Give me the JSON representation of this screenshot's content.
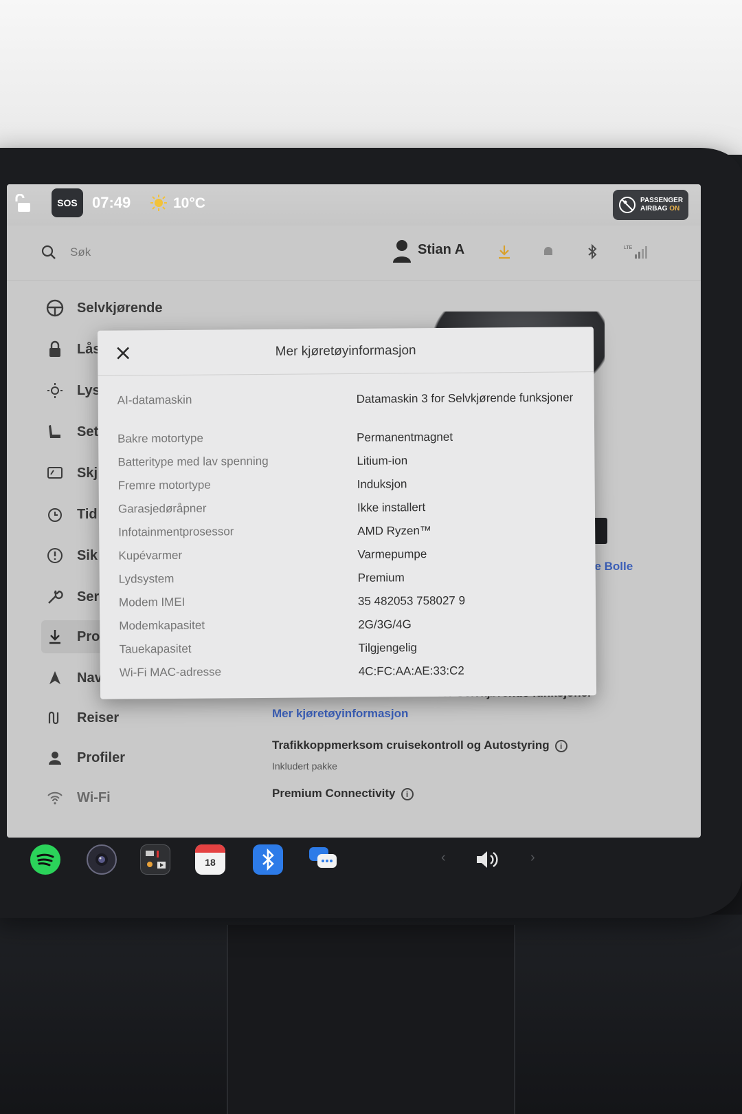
{
  "status_bar": {
    "sos": "SOS",
    "time": "07:49",
    "temperature": "10°C",
    "airbag_line1": "PASSENGER",
    "airbag_line2": "AIRBAG",
    "airbag_state": "ON",
    "airbag_state_color": "#e7b04a"
  },
  "header": {
    "search_placeholder": "Søk",
    "user_name": "Stian A",
    "icons": [
      "download-icon",
      "bell-icon",
      "bluetooth-icon",
      "lte-signal-icon"
    ],
    "download_color": "#d9a12a"
  },
  "sidebar": {
    "items": [
      {
        "label": "Selvkjørende",
        "icon": "steering-wheel-icon"
      },
      {
        "label": "Lås",
        "icon": "lock-icon"
      },
      {
        "label": "Lys",
        "icon": "light-icon"
      },
      {
        "label": "Set",
        "icon": "seat-icon"
      },
      {
        "label": "Skj",
        "icon": "display-icon"
      },
      {
        "label": "Tid",
        "icon": "clock-icon"
      },
      {
        "label": "Sik",
        "icon": "safety-icon"
      },
      {
        "label": "Ser",
        "icon": "wrench-icon"
      },
      {
        "label": "Pro",
        "icon": "download-icon"
      },
      {
        "label": "Nav",
        "icon": "navigation-icon"
      },
      {
        "label": "Reiser",
        "icon": "trips-icon"
      },
      {
        "label": "Profiler",
        "icon": "profile-icon"
      },
      {
        "label": "Wi-Fi",
        "icon": "wifi-icon"
      }
    ]
  },
  "main": {
    "owner_link": "lle Bolle",
    "ai_computer_line": "AI-datamaskin: Datamaskin 3 for Selvkjørende funksjoner",
    "more_info_link": "Mer kjøretøyinformasjon",
    "tacc_line": "Trafikkoppmerksom cruisekontroll og Autostyring",
    "tacc_sub": "Inkludert pakke",
    "connectivity_line": "Premium Connectivity",
    "link_color": "#3b5fb8"
  },
  "modal": {
    "title": "Mer kjøretøyinformasjon",
    "rows": [
      {
        "key": "AI-datamaskin",
        "value": "Datamaskin 3 for Selvkjørende funksjoner"
      },
      {
        "key": "Bakre motortype",
        "value": "Permanentmagnet"
      },
      {
        "key": "Batteritype med lav spenning",
        "value": "Litium-ion"
      },
      {
        "key": "Fremre motortype",
        "value": "Induksjon"
      },
      {
        "key": "Garasjedøråpner",
        "value": "Ikke installert"
      },
      {
        "key": "Infotainmentprosessor",
        "value": "AMD Ryzen™"
      },
      {
        "key": "Kupévarmer",
        "value": "Varmepumpe"
      },
      {
        "key": "Lydsystem",
        "value": "Premium"
      },
      {
        "key": "Modem IMEI",
        "value": "35 482053 758027 9"
      },
      {
        "key": "Modemkapasitet",
        "value": "2G/3G/4G"
      },
      {
        "key": "Tauekapasitet",
        "value": "Tilgjengelig"
      },
      {
        "key": "Wi-Fi MAC-adresse",
        "value": "4C:FC:AA:AE:33:C2"
      }
    ]
  },
  "dock": {
    "apps": [
      "spotify-icon",
      "camera-icon",
      "toybox-icon",
      "calendar-icon",
      "bluetooth-app-icon",
      "messages-icon"
    ],
    "calendar_day": "18",
    "volume_icon": "volume-icon"
  }
}
